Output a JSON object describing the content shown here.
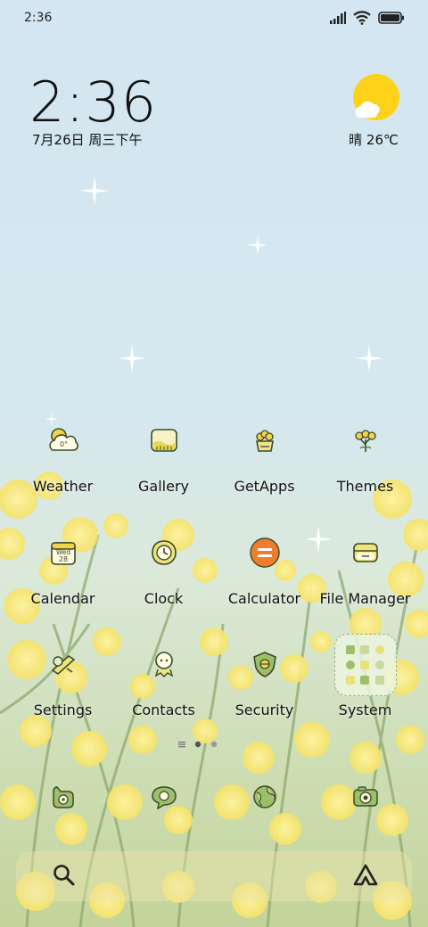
{
  "status_bar": {
    "time": "2:36"
  },
  "lockscreen_clock": {
    "time": "2:36",
    "date": "7月26日 周三下午"
  },
  "weather_widget": {
    "condition": "晴",
    "temperature": "26℃",
    "sun_color": "#ffd21a"
  },
  "apps": [
    {
      "label": "Weather",
      "icon": "weather-icon"
    },
    {
      "label": "Gallery",
      "icon": "gallery-icon"
    },
    {
      "label": "GetApps",
      "icon": "getapps-icon"
    },
    {
      "label": "Themes",
      "icon": "themes-icon"
    },
    {
      "label": "Calendar",
      "icon": "calendar-icon",
      "icon_text": "Wed",
      "icon_number": "28"
    },
    {
      "label": "Clock",
      "icon": "clock-icon"
    },
    {
      "label": "Calculator",
      "icon": "calculator-icon",
      "accent": "#f07d2e"
    },
    {
      "label": "File Manager",
      "icon": "file-manager-icon"
    },
    {
      "label": "Settings",
      "icon": "settings-icon"
    },
    {
      "label": "Contacts",
      "icon": "contacts-icon"
    },
    {
      "label": "Security",
      "icon": "security-icon"
    },
    {
      "label": "System",
      "icon": "folder-icon"
    }
  ],
  "dock": [
    {
      "icon": "phone-icon"
    },
    {
      "icon": "messages-icon"
    },
    {
      "icon": "browser-icon"
    },
    {
      "icon": "camera-icon"
    }
  ],
  "search_bar": {
    "left_icon": "search-icon",
    "right_icon": "assistant-icon"
  },
  "page_indicator": {
    "pages": 2,
    "current": 1
  },
  "colors": {
    "icon_stroke": "#3a4a2c",
    "icon_fill": "#e8e27a",
    "icon_green": "#9cc06a",
    "flower": "#fbe778"
  }
}
